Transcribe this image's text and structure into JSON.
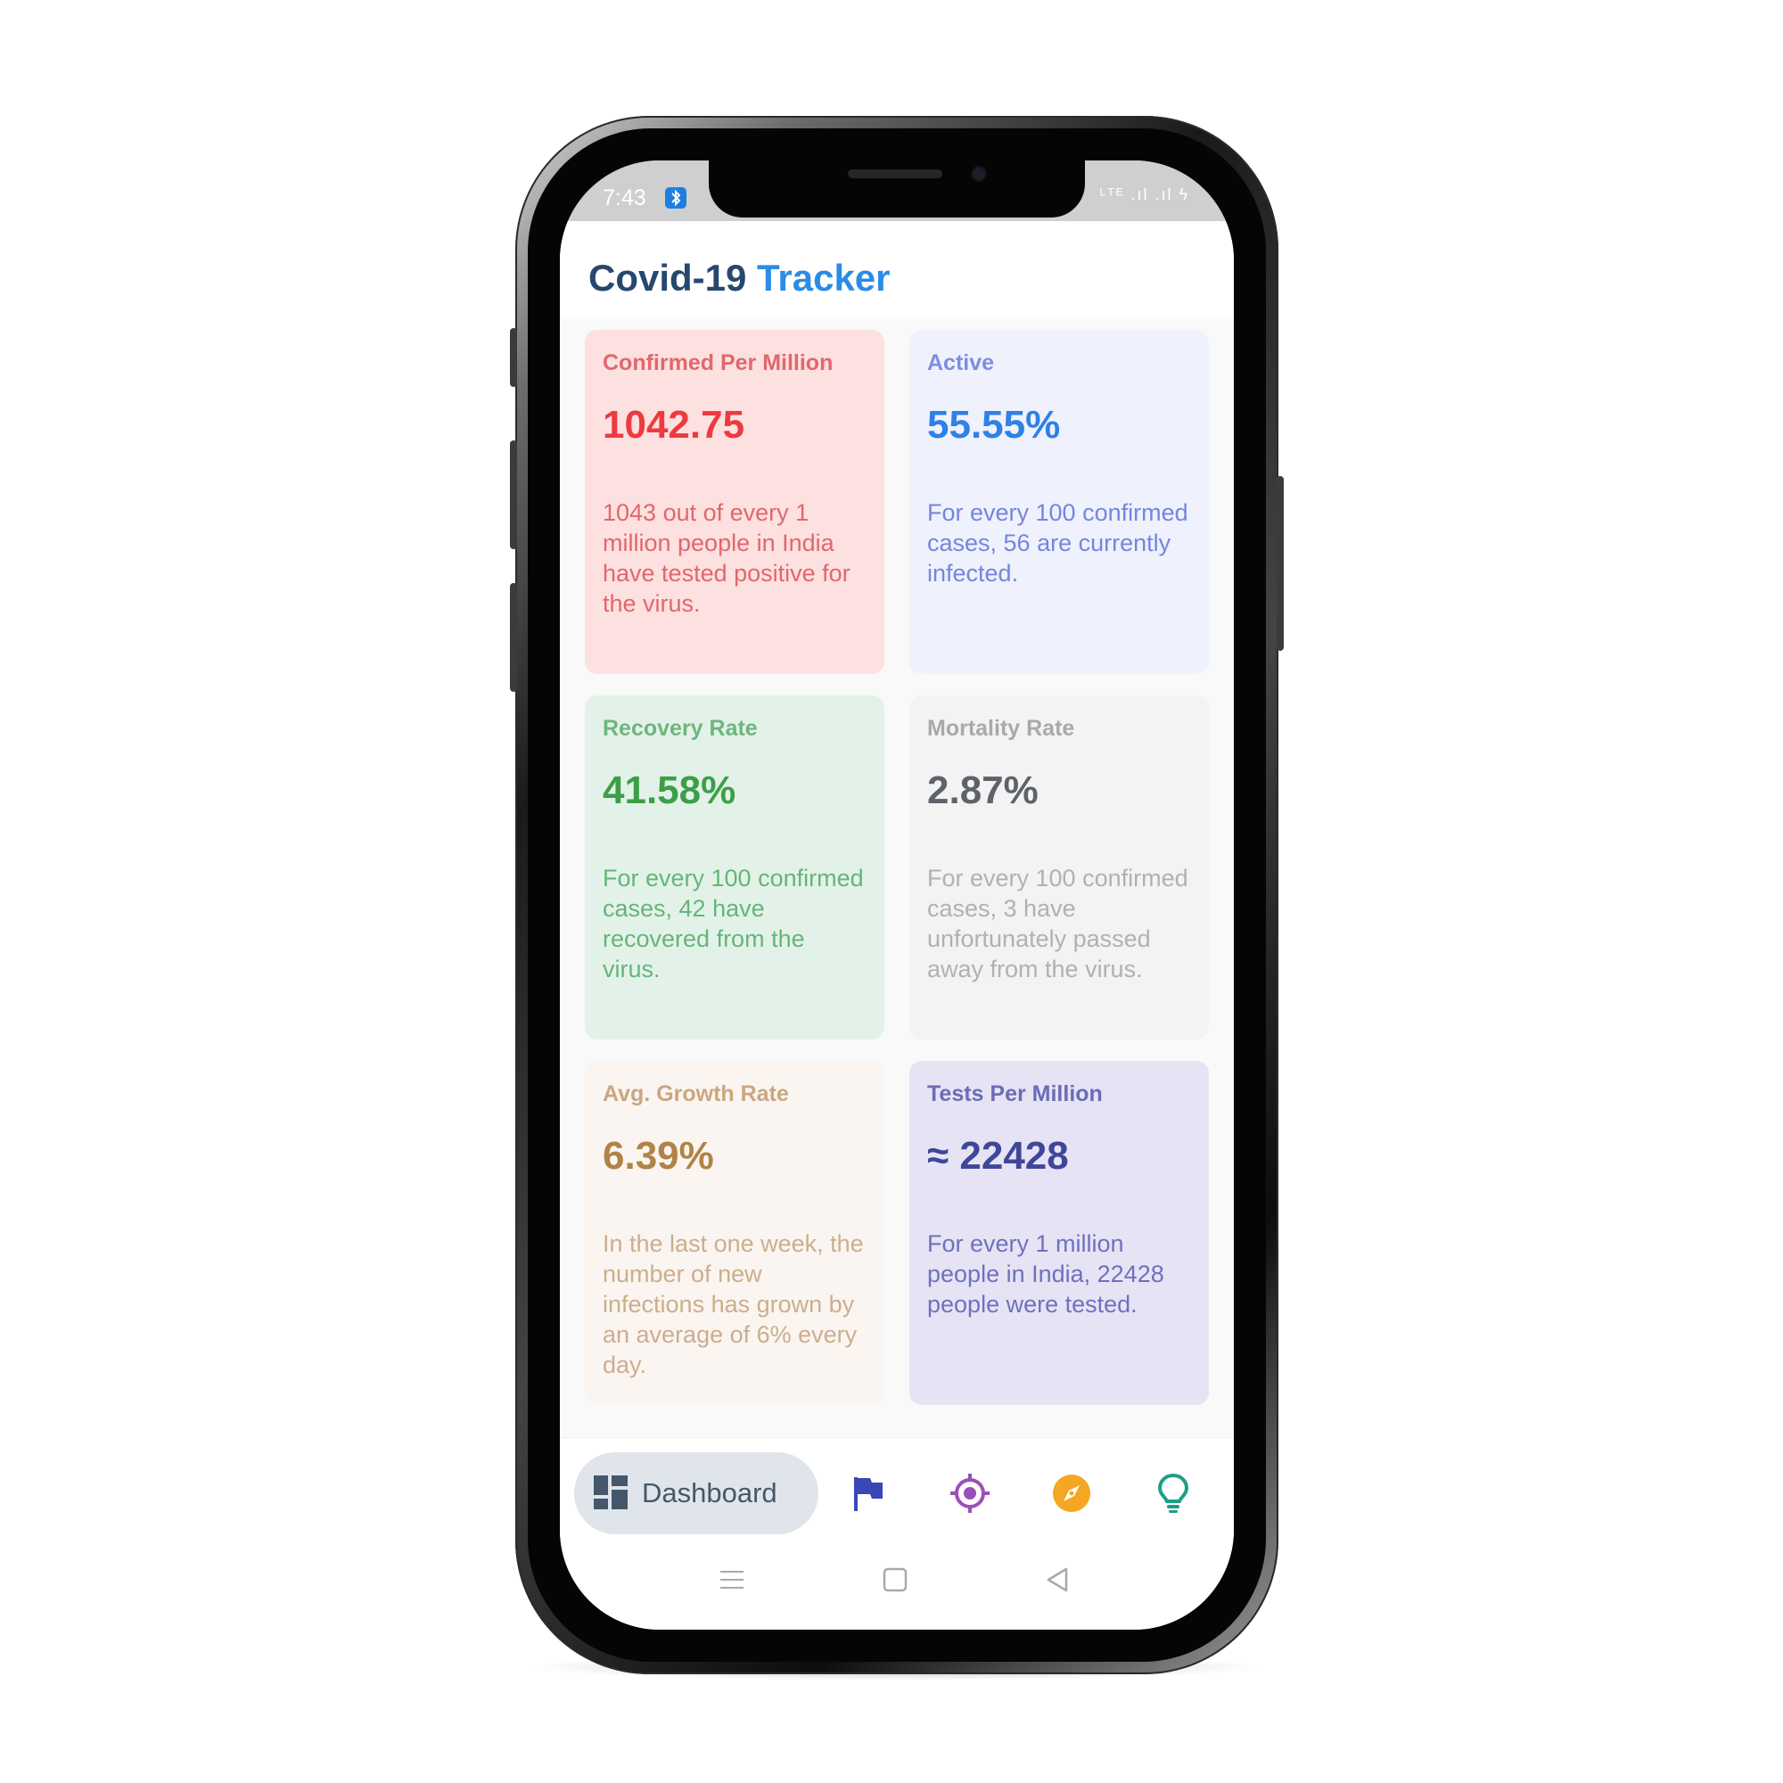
{
  "status_bar": {
    "time": "7:43",
    "right": "ᴸᵀᴱ .ıl .ıl ϟ"
  },
  "header": {
    "title_part1": "Covid-19",
    "title_part2": "Tracker"
  },
  "cards": [
    {
      "title": "Confirmed Per Million",
      "value": "1042.75",
      "description": "1043 out of every 1 million people in India have tested positive for the virus."
    },
    {
      "title": "Active",
      "value": "55.55%",
      "description": "For every 100 confirmed cases, 56 are currently infected."
    },
    {
      "title": "Recovery Rate",
      "value": "41.58%",
      "description": "For every 100 confirmed cases, 42 have recovered from the virus."
    },
    {
      "title": "Mortality Rate",
      "value": "2.87%",
      "description": "For every 100 confirmed cases, 3 have unfortunately passed away from the virus."
    },
    {
      "title": "Avg. Growth Rate",
      "value": "6.39%",
      "description": "In the last one week, the number of new infections has grown by an average of 6% every day."
    },
    {
      "title": "Tests Per Million",
      "value": "≈ 22428",
      "description": "For every 1 million people in India, 22428 people were tested."
    }
  ],
  "bottom_nav": {
    "active_label": "Dashboard",
    "icons": [
      "dashboard-icon",
      "flag-icon",
      "target-icon",
      "compass-icon",
      "lightbulb-icon"
    ]
  },
  "colors": {
    "title_dark": "#27476e",
    "title_accent": "#2b8ce6",
    "confirmed": "#ec3b3f",
    "active": "#2f80e8",
    "recovered": "#3c9f47",
    "deceased": "#5d6368",
    "growth": "#b08347",
    "tests": "#3e4798"
  }
}
